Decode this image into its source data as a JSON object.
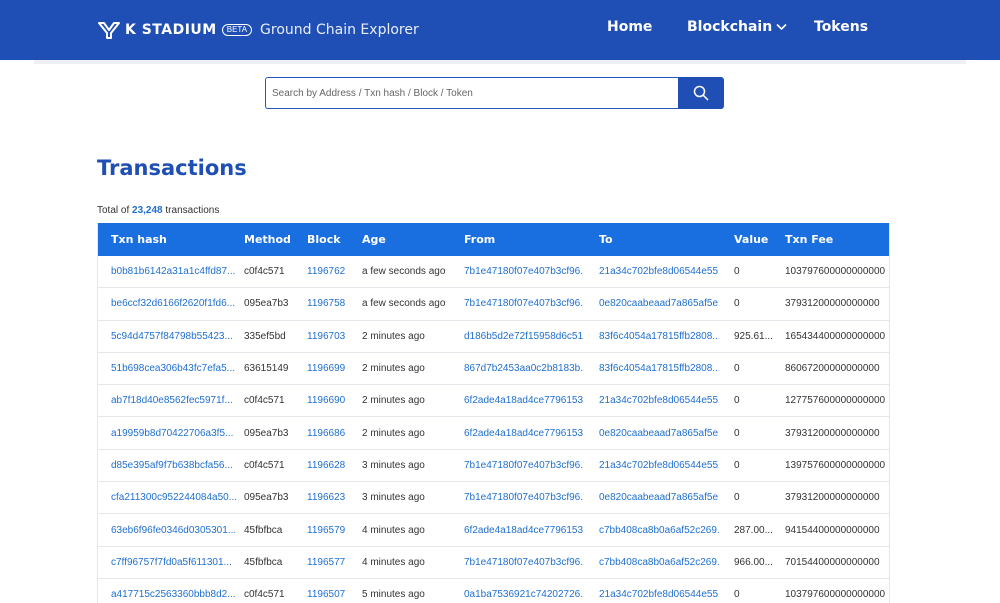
{
  "header": {
    "brand": "K STADIUM",
    "badge": "BETA",
    "subtitle": "Ground Chain Explorer",
    "nav": {
      "home": "Home",
      "blockchain": "Blockchain",
      "tokens": "Tokens"
    }
  },
  "search": {
    "placeholder": "Search by Address / Txn hash / Block / Token"
  },
  "page": {
    "title": "Transactions",
    "total_prefix": "Total of",
    "total_count": "23,248",
    "total_suffix": "transactions"
  },
  "table": {
    "columns": [
      "Txn hash",
      "Method",
      "Block",
      "Age",
      "From",
      "To",
      "Value",
      "Txn Fee"
    ],
    "rows": [
      {
        "hash": "b0b81b6142a31a1c4ffd87...",
        "method": "c0f4c571",
        "block": "1196762",
        "age": "a few seconds ago",
        "from": "7b1e47180f07e407b3cf96...",
        "to": "21a34c702bfe8d06544e55...",
        "value": "0",
        "fee": "103797600000000000"
      },
      {
        "hash": "be6ccf32d6166f2620f1fd6...",
        "method": "095ea7b3",
        "block": "1196758",
        "age": "a few seconds ago",
        "from": "7b1e47180f07e407b3cf96...",
        "to": "0e820caabeaad7a865af5e...",
        "value": "0",
        "fee": "37931200000000000"
      },
      {
        "hash": "5c94d4757f84798b55423...",
        "method": "335ef5bd",
        "block": "1196703",
        "age": "2 minutes ago",
        "from": "d186b5d2e72f15958d6c51...",
        "to": "83f6c4054a17815ffb2808...",
        "value": "925.61...",
        "fee": "165434400000000000"
      },
      {
        "hash": "51b698cea306b43fc7efa5...",
        "method": "63615149",
        "block": "1196699",
        "age": "2 minutes ago",
        "from": "867d7b2453aa0c2b8183b...",
        "to": "83f6c4054a17815ffb2808...",
        "value": "0",
        "fee": "86067200000000000"
      },
      {
        "hash": "ab7f18d40e8562fec5971f...",
        "method": "c0f4c571",
        "block": "1196690",
        "age": "2 minutes ago",
        "from": "6f2ade4a18ad4ce7796153...",
        "to": "21a34c702bfe8d06544e55...",
        "value": "0",
        "fee": "127757600000000000"
      },
      {
        "hash": "a19959b8d70422706a3f5...",
        "method": "095ea7b3",
        "block": "1196686",
        "age": "2 minutes ago",
        "from": "6f2ade4a18ad4ce7796153...",
        "to": "0e820caabeaad7a865af5e...",
        "value": "0",
        "fee": "37931200000000000"
      },
      {
        "hash": "d85e395af9f7b638bcfa56...",
        "method": "c0f4c571",
        "block": "1196628",
        "age": "3 minutes ago",
        "from": "7b1e47180f07e407b3cf96...",
        "to": "21a34c702bfe8d06544e55...",
        "value": "0",
        "fee": "139757600000000000"
      },
      {
        "hash": "cfa211300c952244084a50...",
        "method": "095ea7b3",
        "block": "1196623",
        "age": "3 minutes ago",
        "from": "7b1e47180f07e407b3cf96...",
        "to": "0e820caabeaad7a865af5e...",
        "value": "0",
        "fee": "37931200000000000"
      },
      {
        "hash": "63eb6f96fe0346d0305301...",
        "method": "45fbfbca",
        "block": "1196579",
        "age": "4 minutes ago",
        "from": "6f2ade4a18ad4ce7796153...",
        "to": "c7bb408ca8b0a6af52c269...",
        "value": "287.00...",
        "fee": "94154400000000000"
      },
      {
        "hash": "c7ff96757f7fd0a5f611301...",
        "method": "45fbfbca",
        "block": "1196577",
        "age": "4 minutes ago",
        "from": "7b1e47180f07e407b3cf96...",
        "to": "c7bb408ca8b0a6af52c269...",
        "value": "966.00...",
        "fee": "70154400000000000"
      },
      {
        "hash": "a417715c2563360bbb8d2...",
        "method": "c0f4c571",
        "block": "1196507",
        "age": "5 minutes ago",
        "from": "0a1ba7536921c74202726...",
        "to": "21a34c702bfe8d06544e55...",
        "value": "0",
        "fee": "103797600000000000"
      }
    ]
  }
}
